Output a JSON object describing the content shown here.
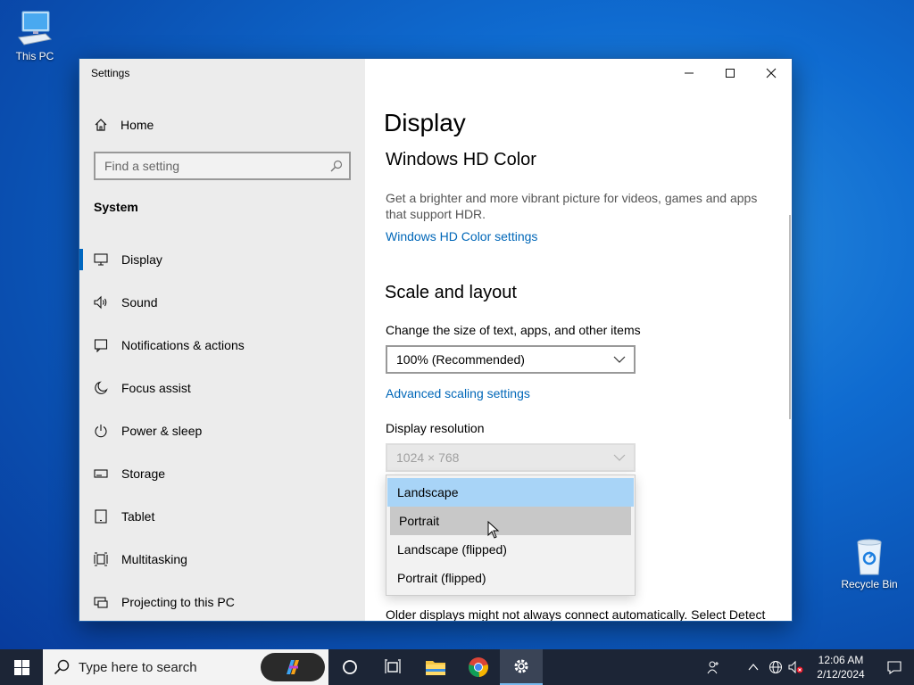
{
  "desktop": {
    "this_pc_label": "This PC",
    "recycle_bin_label": "Recycle Bin"
  },
  "window": {
    "title": "Settings",
    "controls": {
      "minimize_icon": "minimize-icon",
      "maximize_icon": "maximize-icon",
      "close_icon": "close-icon"
    }
  },
  "sidebar": {
    "home_label": "Home",
    "search_placeholder": "Find a setting",
    "section_label": "System",
    "items": [
      {
        "label": "Display",
        "icon": "monitor-icon",
        "active": true
      },
      {
        "label": "Sound",
        "icon": "speaker-icon"
      },
      {
        "label": "Notifications & actions",
        "icon": "notification-icon"
      },
      {
        "label": "Focus assist",
        "icon": "moon-icon"
      },
      {
        "label": "Power & sleep",
        "icon": "power-icon"
      },
      {
        "label": "Storage",
        "icon": "storage-icon"
      },
      {
        "label": "Tablet",
        "icon": "tablet-icon"
      },
      {
        "label": "Multitasking",
        "icon": "multitasking-icon"
      },
      {
        "label": "Projecting to this PC",
        "icon": "projecting-icon"
      }
    ]
  },
  "main": {
    "page_title": "Display",
    "hd_color": {
      "heading": "Windows HD Color",
      "description": "Get a brighter and more vibrant picture for videos, games and apps that support HDR.",
      "link": "Windows HD Color settings"
    },
    "scale_layout": {
      "heading": "Scale and layout",
      "scale_label": "Change the size of text, apps, and other items",
      "scale_value": "100% (Recommended)",
      "advanced_link": "Advanced scaling settings",
      "resolution_label": "Display resolution",
      "resolution_value": "1024 × 768",
      "orientation_options": [
        "Landscape",
        "Portrait",
        "Landscape (flipped)",
        "Portrait (flipped)"
      ],
      "orientation_selected": "Landscape",
      "orientation_hovered": "Portrait"
    },
    "bottom_text": "Older displays might not always connect automatically. Select Detect"
  },
  "taskbar": {
    "search_placeholder": "Type here to search",
    "time": "12:06 AM",
    "date": "2/12/2024"
  },
  "colors": {
    "accent": "#0067c0",
    "link": "#0067b8",
    "selected_option": "#a8d4f7",
    "taskbar": "#1c2536"
  }
}
